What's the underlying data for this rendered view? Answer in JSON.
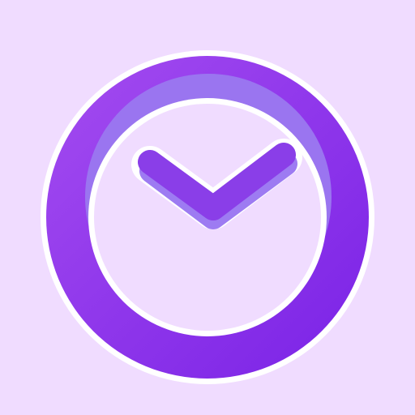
{
  "app_icon": {
    "icon": "clock-icon",
    "colors": {
      "background": "#f0dcff",
      "ring_light": "#a44cf0",
      "ring_dark": "#7a22e6",
      "inner_shadow": "#9a75f0",
      "face": "#f0dcff",
      "hands": "#8a3ee8",
      "hands_shadow": "#9d7bf2",
      "outline": "#ffffff"
    }
  }
}
